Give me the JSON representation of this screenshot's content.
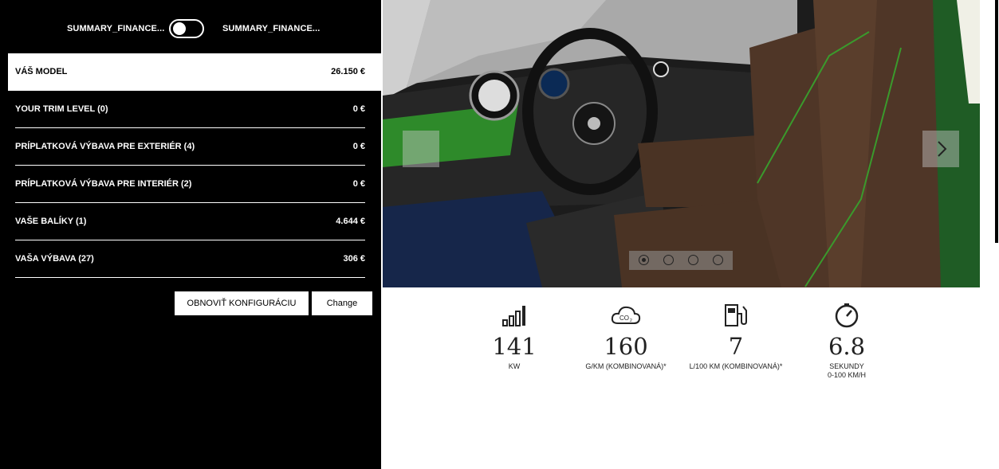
{
  "toggle": {
    "left_label": "SUMMARY_FINANCE...",
    "right_label": "SUMMARY_FINANCE..."
  },
  "summary": {
    "rows": [
      {
        "label": "VÁŠ MODEL",
        "price": "26.150 €"
      },
      {
        "label": "YOUR TRIM LEVEL (0)",
        "price": "0 €"
      },
      {
        "label": "PRÍPLATKOVÁ VÝBAVA PRE EXTERIÉR (4)",
        "price": "0 €"
      },
      {
        "label": "PRÍPLATKOVÁ VÝBAVA PRE INTERIÉR (2)",
        "price": "0 €"
      },
      {
        "label": "VAŠE BALÍKY (1)",
        "price": "4.644 €"
      },
      {
        "label": "VAŠA VÝBAVA (27)",
        "price": "306 €"
      }
    ]
  },
  "buttons": {
    "reset": "OBNOVIŤ KONFIGURÁCIU",
    "change": "Change"
  },
  "gallery": {
    "slide_count": 4,
    "active_slide": 1
  },
  "stats": [
    {
      "icon": "signal-bars-icon",
      "value": "141",
      "unit": "KW"
    },
    {
      "icon": "co2-cloud-icon",
      "value": "160",
      "unit": "G/KM (KOMBINOVANÁ)*"
    },
    {
      "icon": "fuel-pump-icon",
      "value": "7",
      "unit": "L/100 KM (KOMBINOVANÁ)*"
    },
    {
      "icon": "stopwatch-icon",
      "value": "6.8",
      "unit": "SEKUNDY",
      "unit2": "0-100 KM/H"
    }
  ],
  "colors": {
    "panel": "#000000",
    "leather": "#4a3324",
    "accent_green": "#2f8a2a"
  }
}
